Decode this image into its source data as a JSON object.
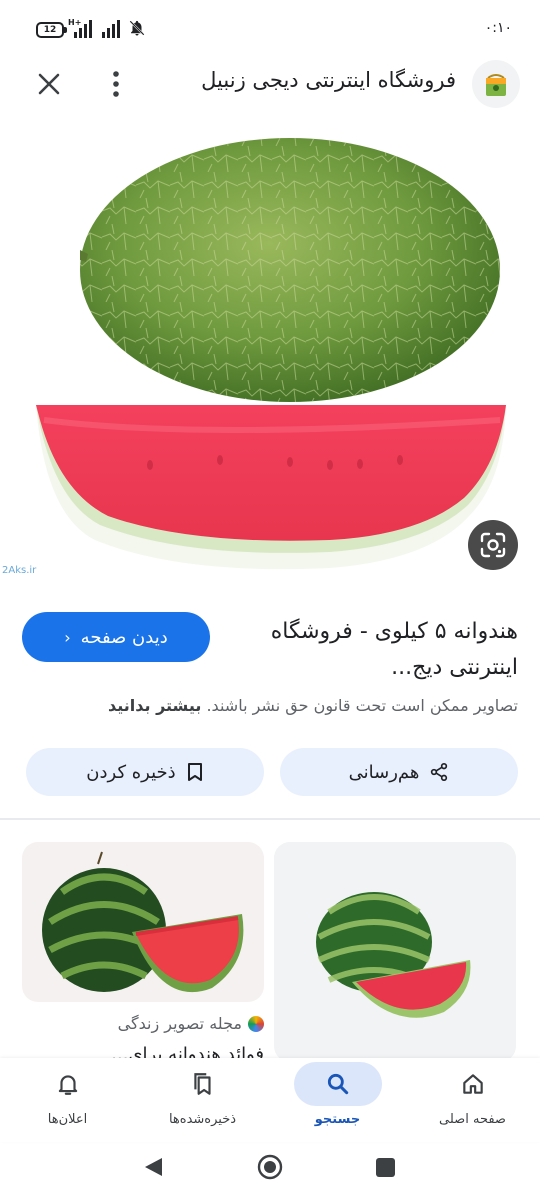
{
  "status_bar": {
    "time": "۰:۱۰",
    "battery": "12",
    "network": "H+"
  },
  "header": {
    "title": "فروشگاه اینترنتی دیجی زنبیل",
    "close_icon": "close-icon",
    "menu_icon": "more-vert-icon",
    "favicon": "shopping-bag-icon"
  },
  "image": {
    "watermark": "2Aks.ir",
    "lens_icon": "google-lens-icon"
  },
  "result": {
    "title": "هندوانه ۵ کیلوی - فروشگاه اینترنتی دیج...",
    "view_button": "دیدن صفحه",
    "copyright_notice": "تصاویر ممکن است تحت قانون حق نشر باشند.",
    "learn_more": "بیشتر بدانید"
  },
  "actions": {
    "share_label": "هم‌رسانی",
    "save_label": "ذخیره کردن"
  },
  "related": {
    "source": "مجله تصویر زندگی",
    "caption": "فوائد هندوانه برای..."
  },
  "bottom_nav": [
    {
      "label": "صفحه اصلی",
      "icon": "home-icon",
      "active": false
    },
    {
      "label": "جستجو",
      "icon": "search-icon",
      "active": true
    },
    {
      "label": "ذخیره‌شده‌ها",
      "icon": "bookmarks-icon",
      "active": false
    },
    {
      "label": "اعلان‌ها",
      "icon": "bell-icon",
      "active": false
    }
  ],
  "colors": {
    "accent": "#1a73e8",
    "chip_bg": "#e8f0fe",
    "active_nav_bg": "#dbe6fb"
  }
}
